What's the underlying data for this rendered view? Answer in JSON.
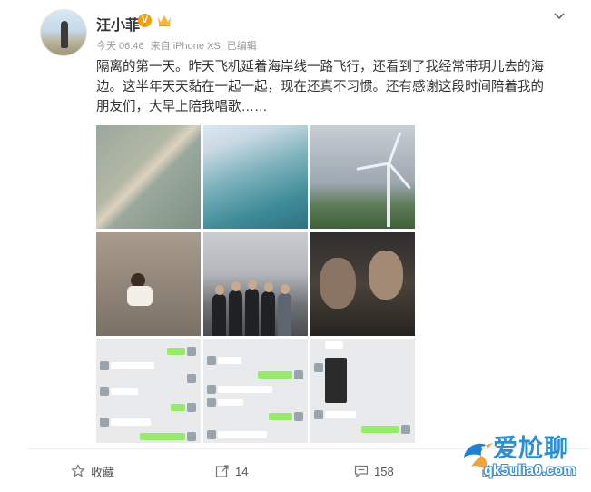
{
  "post": {
    "username": "汪小菲",
    "verified_badge": "V",
    "meta": {
      "time": "今天 06:46",
      "source": "来自 iPhone XS",
      "edited": "已编辑"
    },
    "text": "隔离的第一天。昨天飞机延着海岸线一路飞行，还看到了我经常带玥儿去的海边。这半年天天黏在一起一起，现在还真不习惯。还有感谢这段时间陪着我的朋友们，大早上陪我唱歌……"
  },
  "actions": {
    "favorite_label": "收藏",
    "share_count": "14",
    "comment_count": "158"
  },
  "icons": {
    "menu": "chevron-down-icon",
    "favorite": "star-icon",
    "share": "share-icon",
    "comment": "comment-icon",
    "like": "thumb-up-icon"
  },
  "watermark": {
    "title": "爱尬聊",
    "url": "qk5ulia0.com"
  },
  "colors": {
    "verified": "#f4a000",
    "watermark_blue": "#2b8fd8",
    "chat_green": "#95ec69"
  }
}
